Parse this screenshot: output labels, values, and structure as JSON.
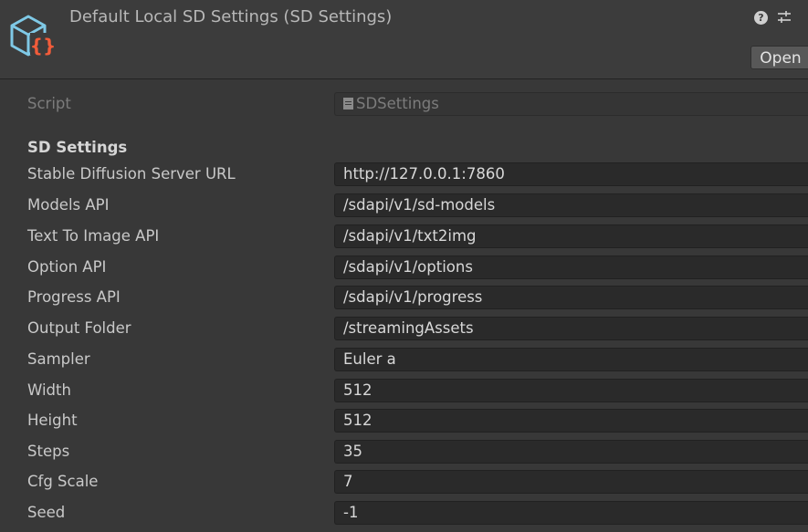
{
  "header": {
    "title": "Default Local SD Settings (SD Settings)",
    "help_icon": "help-icon",
    "preset_icon": "preset-sliders-icon",
    "open_label": "Open",
    "asset_icon": "scriptable-object-icon",
    "colors": {
      "icon_outline": "#7fc9e6",
      "icon_braces": "#f25c3a"
    }
  },
  "script_row": {
    "label": "Script",
    "value": "SDSettings",
    "file_icon": "script-file-icon",
    "picker_icon": "object-picker-icon"
  },
  "section": {
    "title": "SD Settings"
  },
  "fields": [
    {
      "label": "Stable Diffusion Server URL",
      "value": "http://127.0.0.1:7860"
    },
    {
      "label": "Models API",
      "value": "/sdapi/v1/sd-models"
    },
    {
      "label": "Text To Image API",
      "value": "/sdapi/v1/txt2img"
    },
    {
      "label": "Option API",
      "value": "/sdapi/v1/options"
    },
    {
      "label": "Progress API",
      "value": "/sdapi/v1/progress"
    },
    {
      "label": "Output Folder",
      "value": "/streamingAssets"
    },
    {
      "label": "Sampler",
      "value": "Euler a"
    },
    {
      "label": "Width",
      "value": "512"
    },
    {
      "label": "Height",
      "value": "512"
    },
    {
      "label": "Steps",
      "value": "35"
    },
    {
      "label": "Cfg Scale",
      "value": "7"
    },
    {
      "label": "Seed",
      "value": "-1"
    }
  ]
}
